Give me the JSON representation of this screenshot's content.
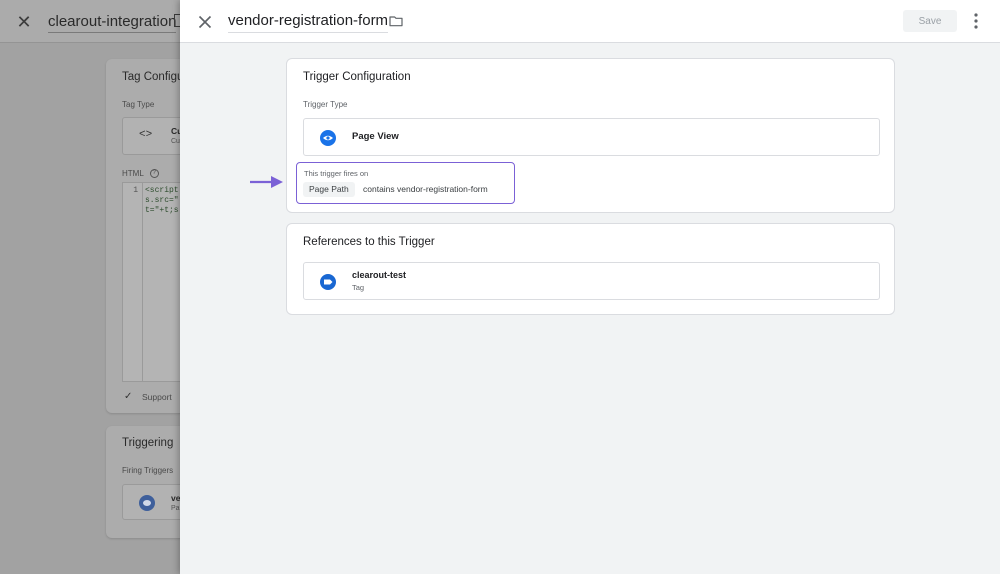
{
  "background_editor": {
    "title": "clearout-integration",
    "tag_configuration_title": "Tag Configu",
    "tag_type_label": "Tag Type",
    "tag_type_name": "Cu",
    "tag_type_sub": "Cu",
    "html_label": "HTML",
    "code_line_number": "1",
    "code_lines": "<script\ns.src=\"\nt=\"+t;s",
    "support_label": "Support",
    "triggering_title": "Triggering",
    "firing_triggers_label": "Firing Triggers",
    "firing_trigger_name": "ve",
    "firing_trigger_sub": "Pa"
  },
  "panel": {
    "title": "vendor-registration-form",
    "save_label": "Save"
  },
  "trigger_configuration": {
    "title": "Trigger Configuration",
    "type_label": "Trigger Type",
    "type_name": "Page View",
    "fires_on_label": "This trigger fires on",
    "condition_variable": "Page Path",
    "condition_text": "contains vendor-registration-form"
  },
  "references": {
    "title": "References to this Trigger",
    "items": [
      {
        "name": "clearout-test",
        "type": "Tag"
      }
    ]
  },
  "colors": {
    "accent_blue": "#1a73e8",
    "highlight_purple": "#7b61d6",
    "disabled_text": "#9aa0a6"
  },
  "icons": {
    "close": "close-icon",
    "folder": "folder-icon",
    "more": "more-vert-icon",
    "trigger_type": "eye-icon",
    "reference": "tag-icon",
    "annotation": "arrow-right-icon"
  }
}
